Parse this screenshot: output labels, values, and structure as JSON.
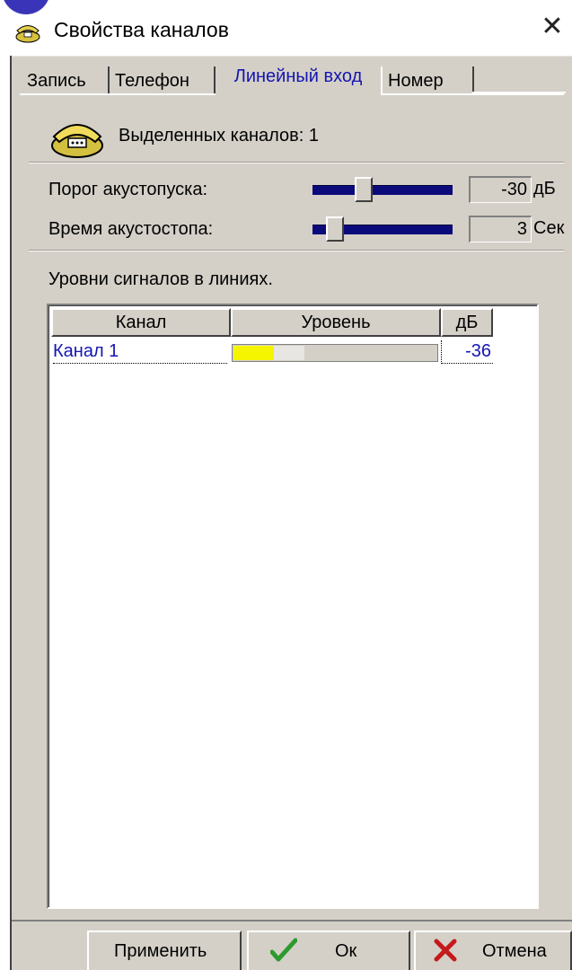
{
  "window": {
    "title": "Свойства каналов",
    "close_glyph": "✕"
  },
  "tabs": [
    {
      "label": "Запись",
      "active": false
    },
    {
      "label": "Телефон",
      "active": false
    },
    {
      "label": "Линейный вход",
      "active": true
    },
    {
      "label": "Номер",
      "active": false
    }
  ],
  "info": {
    "icon": "telephone-icon",
    "text": "Выделенных каналов: 1"
  },
  "settings": {
    "threshold": {
      "label": "Порог акустопуска:",
      "value": "-30",
      "unit": "дБ",
      "slider_position": 0.35
    },
    "stop_time": {
      "label": "Время акустостопа:",
      "value": "3",
      "unit": "Сек",
      "slider_position": 0.12
    }
  },
  "levels": {
    "caption": "Уровни сигналов в линиях.",
    "columns": [
      "Канал",
      "Уровень",
      "дБ"
    ],
    "rows": [
      {
        "channel": "Канал 1",
        "level_fraction": 0.2,
        "db": "-36"
      }
    ]
  },
  "buttons": {
    "apply": "Применить",
    "ok": "Ок",
    "cancel": "Отмена"
  },
  "colors": {
    "accent_text": "#1515b0",
    "slider_track": "#0a0a7a",
    "level_fill": "#f5f500",
    "ok_check": "#2e9a2e",
    "cancel_x": "#c41a1a"
  }
}
